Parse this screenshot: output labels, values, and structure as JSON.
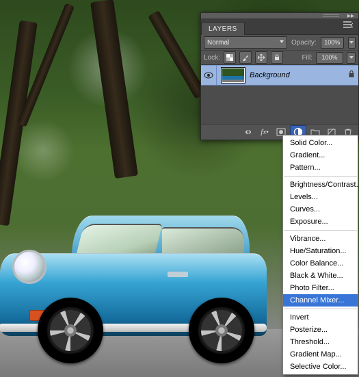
{
  "panel": {
    "tab_label": "LAYERS",
    "blend_mode": "Normal",
    "opacity_label": "Opacity:",
    "opacity_value": "100%",
    "lock_label": "Lock:",
    "fill_label": "Fill:",
    "fill_value": "100%",
    "layers": [
      {
        "name": "Background",
        "locked": true,
        "visible": true
      }
    ]
  },
  "menu": {
    "groups": [
      [
        "Solid Color...",
        "Gradient...",
        "Pattern..."
      ],
      [
        "Brightness/Contrast...",
        "Levels...",
        "Curves...",
        "Exposure..."
      ],
      [
        "Vibrance...",
        "Hue/Saturation...",
        "Color Balance...",
        "Black & White...",
        "Photo Filter...",
        "Channel Mixer..."
      ],
      [
        "Invert",
        "Posterize...",
        "Threshold...",
        "Gradient Map...",
        "Selective Color..."
      ]
    ],
    "selected": "Channel Mixer..."
  }
}
